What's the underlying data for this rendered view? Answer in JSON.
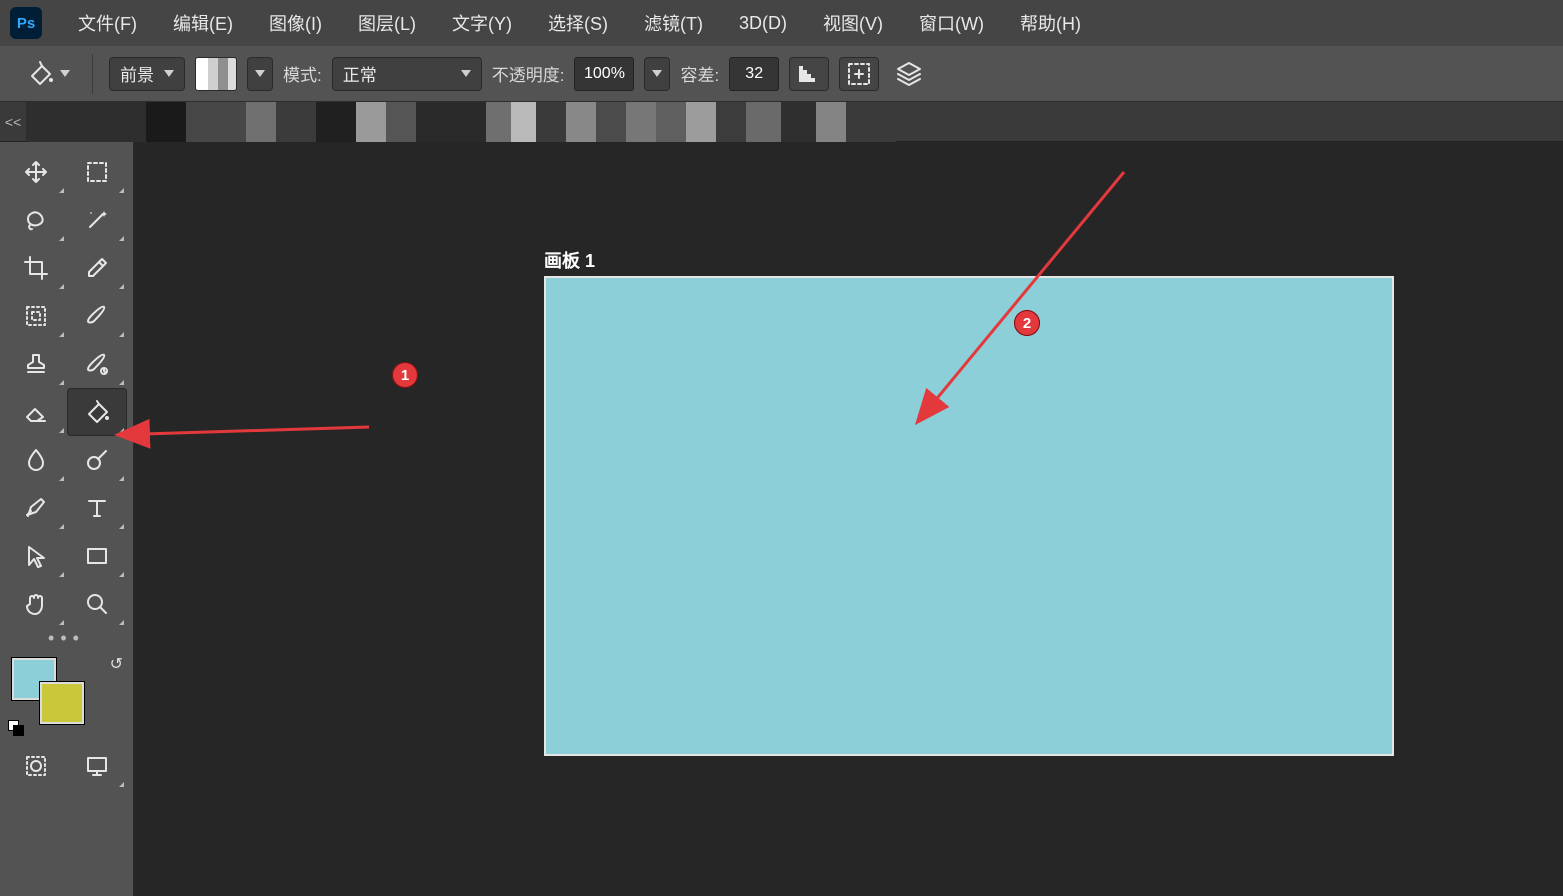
{
  "app": {
    "logo_text": "Ps"
  },
  "menu": {
    "file": "文件(F)",
    "edit": "编辑(E)",
    "image": "图像(I)",
    "layer": "图层(L)",
    "type": "文字(Y)",
    "select": "选择(S)",
    "filter": "滤镜(T)",
    "threeD": "3D(D)",
    "view": "视图(V)",
    "window": "窗口(W)",
    "help": "帮助(H)"
  },
  "options": {
    "fill_source_label": "前景",
    "mode_label": "模式:",
    "mode_value": "正常",
    "opacity_label": "不透明度:",
    "opacity_value": "100%",
    "tolerance_label": "容差:",
    "tolerance_value": "32"
  },
  "doctabs": {
    "collapse_label": "<<"
  },
  "canvas": {
    "artboard_label": "画板 1",
    "fill_color": "#8ccfd9"
  },
  "swatches": {
    "foreground": "#8ccfd9",
    "background": "#c9c83a"
  },
  "annotations": {
    "badge1": "1",
    "badge2": "2"
  }
}
